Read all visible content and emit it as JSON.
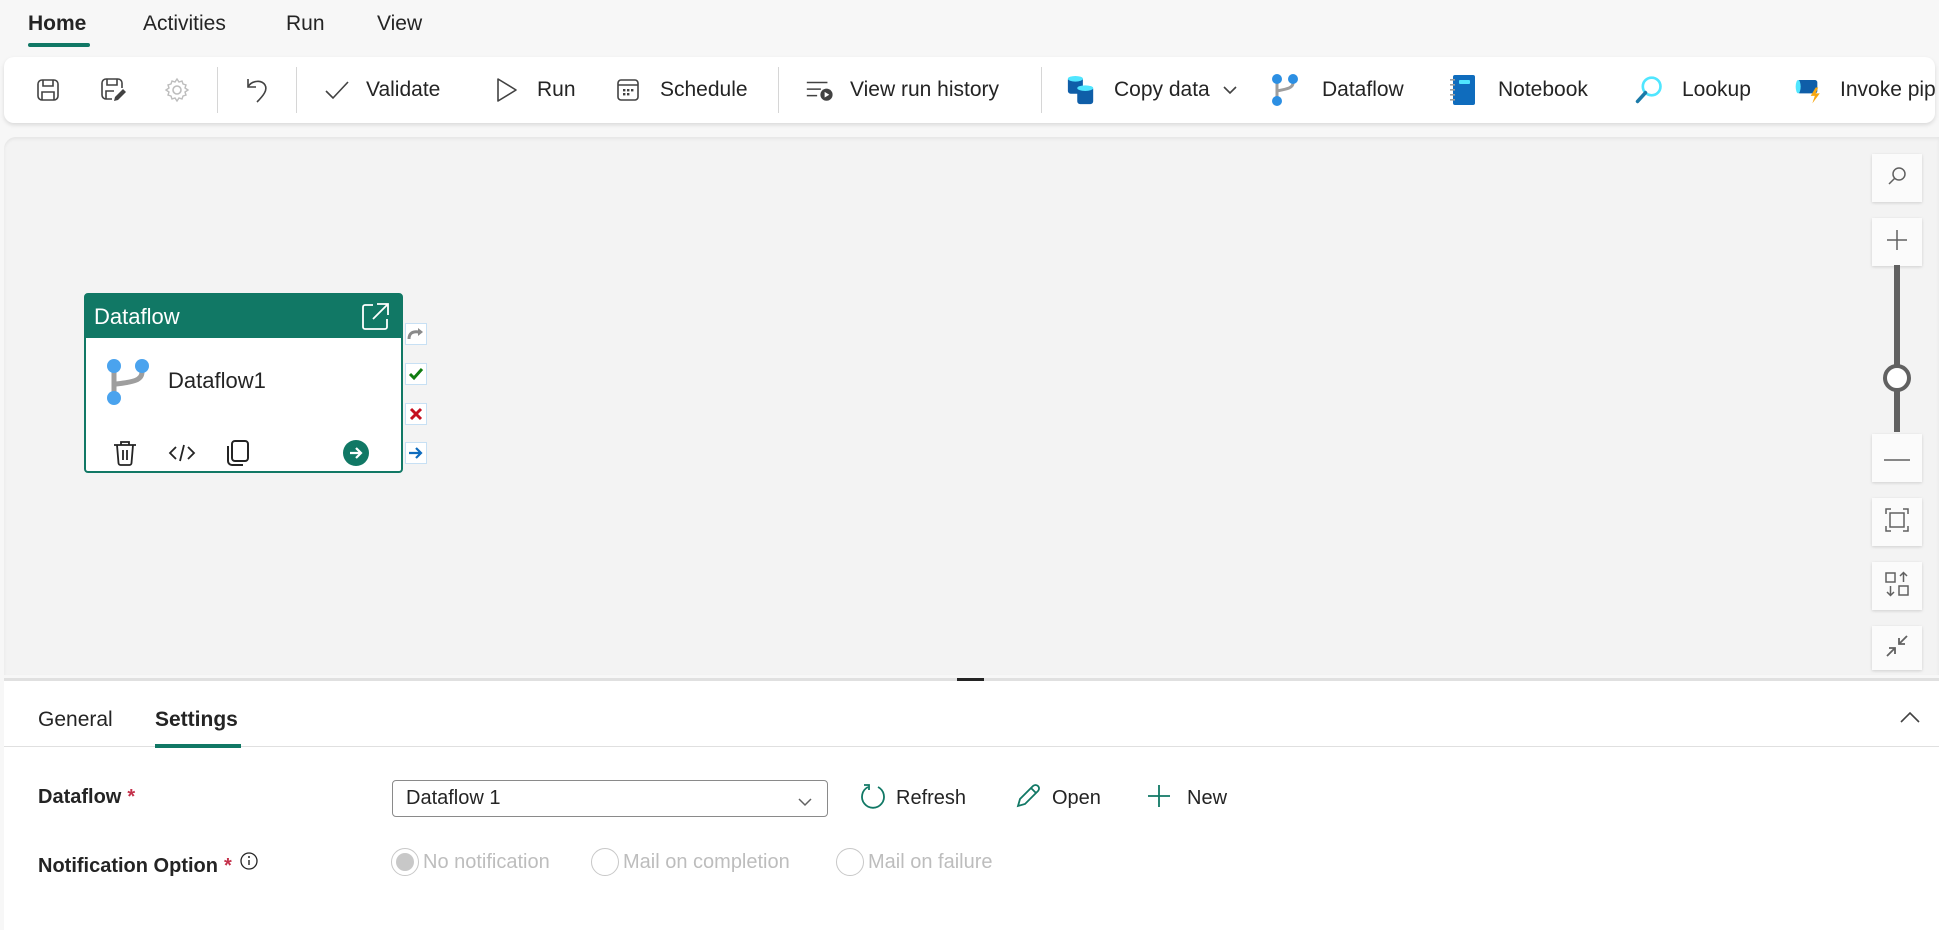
{
  "top_tabs": [
    {
      "label": "Home",
      "active": true
    },
    {
      "label": "Activities",
      "active": false
    },
    {
      "label": "Run",
      "active": false
    },
    {
      "label": "View",
      "active": false
    }
  ],
  "toolbar": {
    "save_icon": "save-icon",
    "save_as_icon": "save-edit-icon",
    "settings_icon": "gear-icon",
    "undo_icon": "undo-icon",
    "validate_label": "Validate",
    "run_label": "Run",
    "schedule_label": "Schedule",
    "view_run_history_label": "View run history",
    "copy_data_label": "Copy data",
    "dataflow_label": "Dataflow",
    "notebook_label": "Notebook",
    "lookup_label": "Lookup",
    "invoke_pipeline_label": "Invoke pipeline"
  },
  "canvas": {
    "activity": {
      "type_label": "Dataflow",
      "name": "Dataflow1",
      "header_color": "#117865"
    },
    "zoom_slider_level": 0.6
  },
  "bottom_panel": {
    "tabs": [
      {
        "label": "General",
        "active": false
      },
      {
        "label": "Settings",
        "active": true
      }
    ],
    "dataflow_field": {
      "label": "Dataflow",
      "required_mark": "*",
      "value": "Dataflow 1"
    },
    "actions": {
      "refresh_label": "Refresh",
      "open_label": "Open",
      "new_label": "New"
    },
    "notification_field": {
      "label": "Notification Option",
      "required_mark": "*",
      "options": [
        {
          "label": "No notification",
          "selected": true,
          "disabled": true
        },
        {
          "label": "Mail on completion",
          "selected": false,
          "disabled": true
        },
        {
          "label": "Mail on failure",
          "selected": false,
          "disabled": true
        }
      ]
    }
  },
  "colors": {
    "accent": "#117865",
    "required": "#c4314b",
    "success": "#107c10",
    "failure": "#c50f1f",
    "completion": "#0f6cbd"
  }
}
